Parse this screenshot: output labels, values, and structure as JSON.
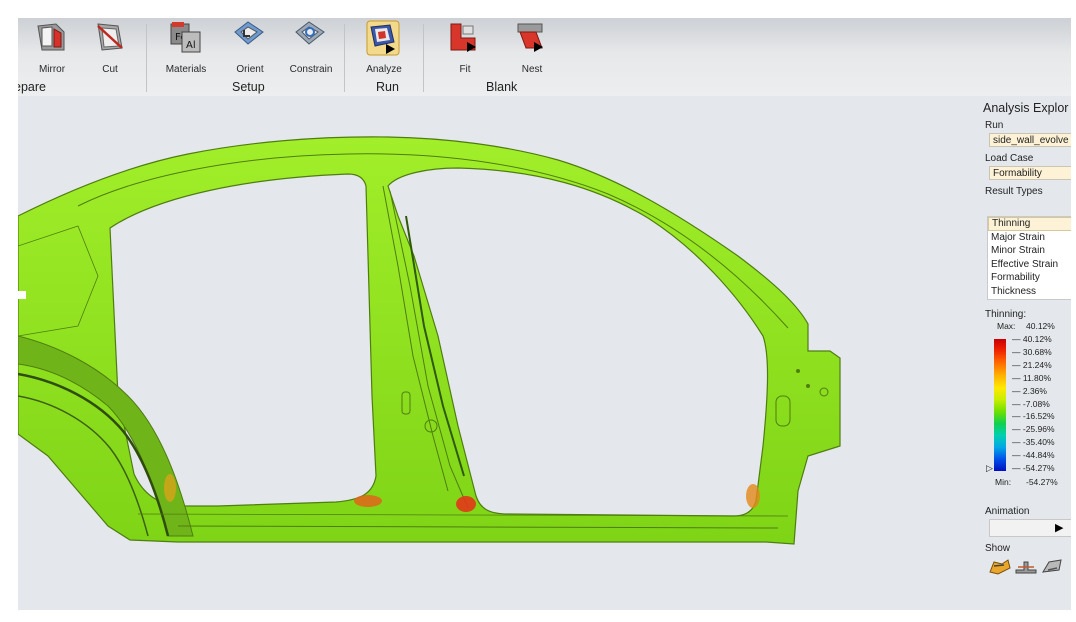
{
  "ribbon": {
    "buttons": {
      "mirror": "Mirror",
      "cut": "Cut",
      "materials": "Materials",
      "orient": "Orient",
      "constrain": "Constrain",
      "analyze": "Analyze",
      "fit": "Fit",
      "nest": "Nest"
    },
    "groups": {
      "prepare": "epare",
      "setup": "Setup",
      "run": "Run",
      "blank": "Blank"
    }
  },
  "panel": {
    "title": "Analysis Explor",
    "run_label": "Run",
    "run_value": "side_wall_evolve",
    "loadcase_label": "Load Case",
    "loadcase_value": "Formability",
    "resulttypes_label": "Result Types",
    "result_types": [
      "Thinning",
      "Major Strain",
      "Minor Strain",
      "Effective Strain",
      "Formability",
      "Thickness"
    ],
    "selected_result": "Thinning",
    "legend": {
      "title": "Thinning:",
      "max_label": "Max:",
      "max_value": "40.12%",
      "min_label": "Min:",
      "min_value": "-54.27%",
      "ticks": [
        "40.12%",
        "30.68%",
        "21.24%",
        "11.80%",
        "2.36%",
        "-7.08%",
        "-16.52%",
        "-25.96%",
        "-35.40%",
        "-44.84%",
        "-54.27%"
      ]
    },
    "animation_label": "Animation",
    "show_label": "Show"
  },
  "colors": {
    "part_green": "#8ee21a",
    "part_edge": "#4f7d10",
    "hot_red": "#e2371a",
    "selected_bg": "#fdf2d6"
  }
}
